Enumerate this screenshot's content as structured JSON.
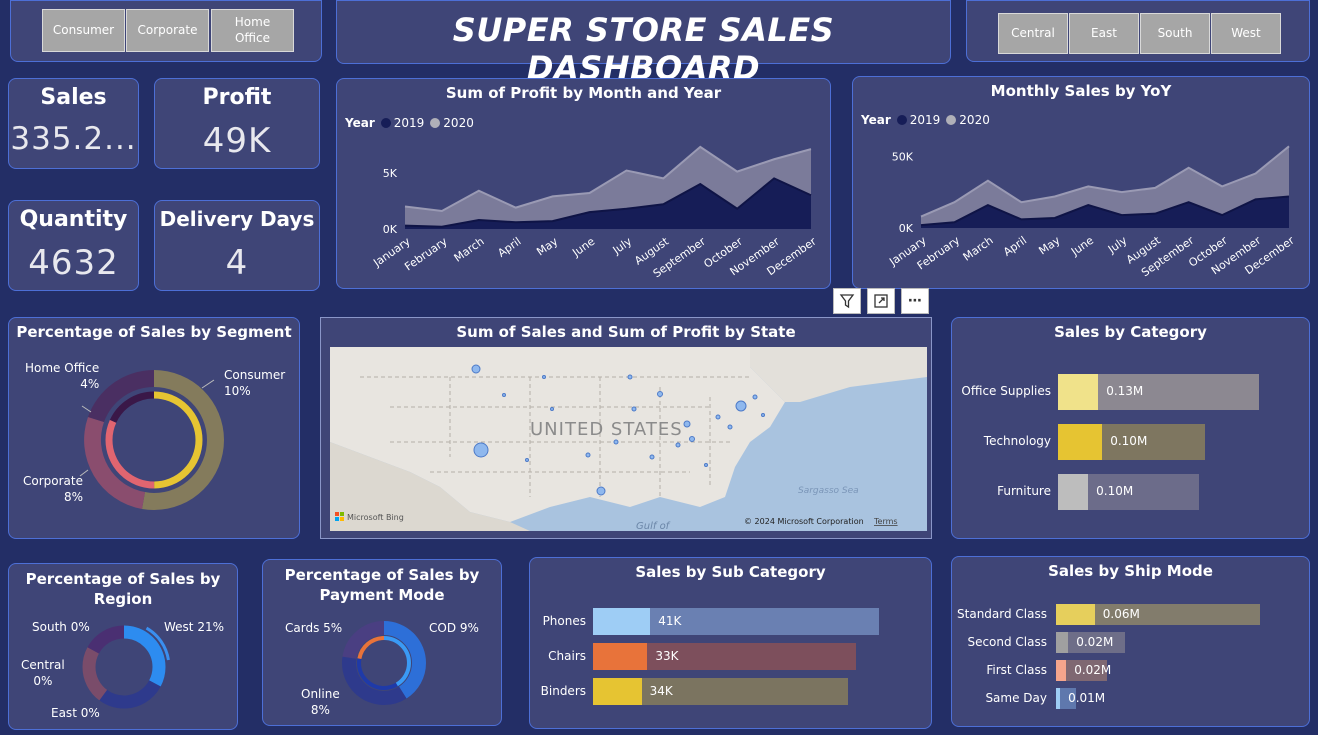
{
  "title": "SUPER STORE SALES DASHBOARD",
  "segment_slicer": [
    "Consumer",
    "Corporate",
    "Home Office"
  ],
  "region_slicer": [
    "Central",
    "East",
    "South",
    "West"
  ],
  "kpis": {
    "sales": {
      "label": "Sales",
      "value": "335.2..."
    },
    "profit": {
      "label": "Profit",
      "value": "49K"
    },
    "quantity": {
      "label": "Quantity",
      "value": "4632"
    },
    "delivery": {
      "label": "Delivery Days",
      "value": "4"
    }
  },
  "colors": {
    "series2019": "#161d57",
    "series2020": "#7b7b9a",
    "accent_border": "#4d6fd6"
  },
  "profit_chart": {
    "title": "Sum of Profit by Month and Year",
    "legend_title": "Year",
    "series_names": [
      "2019",
      "2020"
    ],
    "y_ticks": [
      "5K",
      "0K"
    ],
    "months": [
      "January",
      "February",
      "March",
      "April",
      "May",
      "June",
      "July",
      "August",
      "September",
      "October",
      "November",
      "December"
    ]
  },
  "sales_chart": {
    "title": "Monthly Sales by YoY",
    "legend_title": "Year",
    "series_names": [
      "2019",
      "2020"
    ],
    "y_ticks": [
      "50K",
      "0K"
    ],
    "months": [
      "January",
      "February",
      "March",
      "April",
      "May",
      "June",
      "July",
      "August",
      "September",
      "October",
      "November",
      "December"
    ]
  },
  "chart_data": [
    {
      "type": "area",
      "title": "Sum of Profit by Month and Year",
      "categories": [
        "January",
        "February",
        "March",
        "April",
        "May",
        "June",
        "July",
        "August",
        "September",
        "October",
        "November",
        "December"
      ],
      "series": [
        {
          "name": "2019",
          "values": [
            300,
            200,
            800,
            600,
            700,
            1500,
            1800,
            2200,
            4000,
            1800,
            4500,
            3000
          ]
        },
        {
          "name": "2020",
          "values": [
            2000,
            1600,
            3400,
            1900,
            2900,
            3200,
            5200,
            4500,
            7300,
            5100,
            6200,
            7100
          ]
        }
      ],
      "ylim": [
        0,
        8000
      ]
    },
    {
      "type": "area",
      "title": "Monthly Sales by YoY",
      "categories": [
        "January",
        "February",
        "March",
        "April",
        "May",
        "June",
        "July",
        "August",
        "September",
        "October",
        "November",
        "December"
      ],
      "series": [
        {
          "name": "2019",
          "values": [
            2000,
            4000,
            16000,
            6000,
            7000,
            16000,
            9000,
            10000,
            18000,
            9000,
            20000,
            22000
          ]
        },
        {
          "name": "2020",
          "values": [
            8000,
            18000,
            33000,
            18000,
            22000,
            29000,
            25000,
            28000,
            42000,
            29000,
            38000,
            57000
          ]
        }
      ],
      "ylim": [
        0,
        60000
      ]
    }
  ],
  "segment_donut": {
    "title": "Percentage of Sales by Segment",
    "labels": [
      {
        "name": "Consumer",
        "pct": "10%"
      },
      {
        "name": "Corporate",
        "pct": "8%"
      },
      {
        "name": "Home Office",
        "pct": "4%"
      }
    ],
    "colors": [
      "#847b5c",
      "#8a4d6e",
      "#4a2f62",
      "#e6c432",
      "#e06570",
      "#3a1848"
    ]
  },
  "map": {
    "title": "Sum of Sales and Sum of Profit by State",
    "country_label": "UNITED STATES",
    "gulf_label": "Gulf of",
    "sargasso_label": "Sargasso Sea",
    "bing_label": "Microsoft Bing",
    "copyright": "© 2024 Microsoft Corporation",
    "terms": "Terms"
  },
  "category_chart": {
    "title": "Sales by Category",
    "rows": [
      {
        "label": "Office Supplies",
        "value": "0.13M",
        "fill": 0.2,
        "total": 1.0,
        "color": "#f0e28a",
        "track": "#8c8891"
      },
      {
        "label": "Technology",
        "value": "0.10M",
        "fill": 0.22,
        "total": 0.73,
        "color": "#e6c432",
        "track": "#7e7660"
      },
      {
        "label": "Furniture",
        "value": "0.10M",
        "fill": 0.15,
        "total": 0.7,
        "color": "#bdbdbd",
        "track": "#6c6c8a"
      }
    ]
  },
  "region_donut": {
    "title_line1": "Percentage of Sales by",
    "title_line2": "Region",
    "labels": [
      {
        "name": "South",
        "pct": "0%"
      },
      {
        "name": "West",
        "pct": "21%"
      },
      {
        "name": "Central",
        "pct": "0%"
      },
      {
        "name": "East",
        "pct": "0%"
      }
    ]
  },
  "payment_donut": {
    "title_line1": "Percentage of Sales by",
    "title_line2": "Payment Mode",
    "labels": [
      {
        "name": "Cards",
        "pct": "5%"
      },
      {
        "name": "COD",
        "pct": "9%"
      },
      {
        "name": "Online",
        "pct": "8%"
      }
    ]
  },
  "subcategory_chart": {
    "title": "Sales by Sub Category",
    "rows": [
      {
        "label": "Phones",
        "value": "41K",
        "fill": 0.2,
        "total": 1.0,
        "color": "#9ecdf5",
        "track": "#6a80b2"
      },
      {
        "label": "Chairs",
        "value": "33K",
        "fill": 0.19,
        "total": 0.92,
        "color": "#e8733a",
        "track": "#7d4f5c"
      },
      {
        "label": "Binders",
        "value": "34K",
        "fill": 0.17,
        "total": 0.89,
        "color": "#e6c432",
        "track": "#7b7460"
      }
    ]
  },
  "shipmode_chart": {
    "title": "Sales by Ship Mode",
    "rows": [
      {
        "label": "Standard Class",
        "value": "0.06M",
        "fill": 0.19,
        "total": 1.0,
        "color": "#e6cf5c",
        "track": "#827c6c"
      },
      {
        "label": "Second Class",
        "value": "0.02M",
        "fill": 0.06,
        "total": 0.34,
        "color": "#a0a0a0",
        "track": "#6e6e88"
      },
      {
        "label": "First Class",
        "value": "0.02M",
        "fill": 0.05,
        "total": 0.25,
        "color": "#f5a58c",
        "track": "#7f6872"
      },
      {
        "label": "Same Day",
        "value": "0.01M",
        "fill": 0.02,
        "total": 0.1,
        "color": "#9ecdf5",
        "track": "#5f78ad"
      }
    ]
  }
}
